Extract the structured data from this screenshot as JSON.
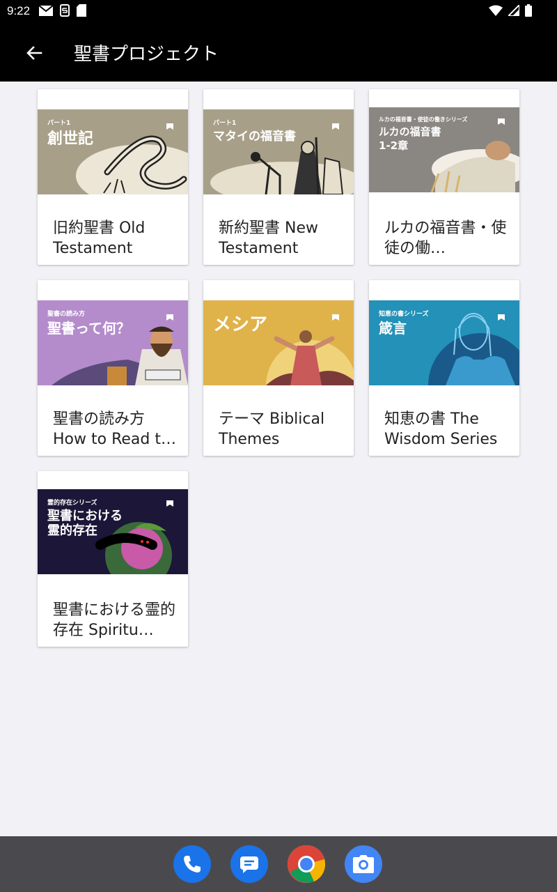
{
  "status_bar": {
    "time": "9:22"
  },
  "app_bar": {
    "title": "聖書プロジェクト"
  },
  "cards": [
    {
      "title": "旧約聖書 Old Testament",
      "thumb_kicker": "パート1",
      "thumb_title": "創世記"
    },
    {
      "title": "新約聖書 New Testament",
      "thumb_kicker": "パート1",
      "thumb_title": "マタイの福音書"
    },
    {
      "title": "ルカの福音書・使徒の働…",
      "thumb_kicker": "ルカの福音書・使徒の働きシリーズ",
      "thumb_title": "ルカの福音書",
      "thumb_title2": "1-2章"
    },
    {
      "title": "聖書の読み方 How to Read t…",
      "thumb_kicker": "聖書の読み方",
      "thumb_title": "聖書って何？"
    },
    {
      "title": "テーマ Biblical Themes",
      "thumb_kicker": "",
      "thumb_title": "メシア"
    },
    {
      "title": "知恵の書 The Wisdom Series",
      "thumb_kicker": "知恵の書シリーズ",
      "thumb_title": "箴言"
    },
    {
      "title": "聖書における霊的存在 Spiritu…",
      "thumb_kicker": "霊的存在シリーズ",
      "thumb_title": "聖書における",
      "thumb_title2": "霊的存在"
    }
  ],
  "colors": {
    "app_bar": "#000000",
    "background": "#f1f1f6",
    "thumb_genesis": "#a89f89",
    "thumb_matthew": "#a89f89",
    "thumb_luke": "#8a8782",
    "thumb_how_to_read": "#b48ccb",
    "thumb_messiah": "#e0b24a",
    "thumb_wisdom": "#2391b8",
    "thumb_spiritual": "#1c1638"
  },
  "dock": {
    "icons": [
      "phone-icon",
      "messages-icon",
      "chrome-icon",
      "camera-icon"
    ]
  }
}
